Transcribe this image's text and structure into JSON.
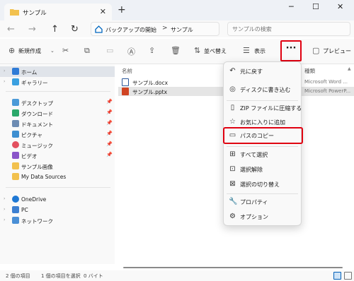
{
  "window": {
    "tab_title": "サンプル",
    "tab_close": "✕",
    "new_tab": "+",
    "minimize": "─",
    "maximize": "☐",
    "close": "✕"
  },
  "address": {
    "back": "←",
    "forward": "→",
    "up": "↑",
    "refresh": "↻",
    "crumb_root": "バックアップの開始",
    "separator": ">",
    "crumb_current": "サンプル",
    "search_placeholder": "サンプルの検索"
  },
  "toolbar": {
    "new_label": "新規作成",
    "sort_label": "並べ替え",
    "view_label": "表示",
    "more_label": "···",
    "preview_label": "プレビュー"
  },
  "sidebar": {
    "home": "ホーム",
    "gallery": "ギャラリー",
    "quick": [
      {
        "label": "デスクトップ",
        "pin": "📌"
      },
      {
        "label": "ダウンロード",
        "pin": "📌"
      },
      {
        "label": "ドキュメント",
        "pin": "📌"
      },
      {
        "label": "ピクチャ",
        "pin": "📌"
      },
      {
        "label": "ミュージック",
        "pin": "📌"
      },
      {
        "label": "ビデオ",
        "pin": "📌"
      },
      {
        "label": "サンプル画像",
        "pin": ""
      },
      {
        "label": "My Data Sources",
        "pin": ""
      }
    ],
    "onedrive": "OneDrive",
    "pc": "PC",
    "network": "ネットワーク"
  },
  "files": {
    "col_name": "名前",
    "col_type": "種類",
    "rows": [
      {
        "name": "サンプル.docx",
        "type": "Microsoft Word ..."
      },
      {
        "name": "サンプル.pptx",
        "type": "Microsoft PowerP..."
      }
    ]
  },
  "status": {
    "count": "2 個の項目",
    "selected": "1 個の項目を選択",
    "size": "0 バイト"
  },
  "menu": {
    "items": [
      {
        "label": "元に戻す",
        "icon": "undo-icon"
      },
      {
        "label": "ディスクに書き込む",
        "icon": "disc-icon"
      },
      {
        "label": "ZIP ファイルに圧縮する",
        "icon": "zip-icon"
      },
      {
        "label": "お気に入りに追加",
        "icon": "star-icon"
      },
      {
        "label": "パスのコピー",
        "icon": "copy-path-icon"
      },
      {
        "label": "すべて選択",
        "icon": "select-all-icon"
      },
      {
        "label": "選択解除",
        "icon": "select-none-icon"
      },
      {
        "label": "選択の切り替え",
        "icon": "invert-selection-icon"
      },
      {
        "label": "プロパティ",
        "icon": "properties-icon"
      },
      {
        "label": "オプション",
        "icon": "options-icon"
      }
    ]
  },
  "colors": {
    "highlight": "#e00010",
    "folder": "#f2c14e",
    "accent": "#005fb8"
  }
}
